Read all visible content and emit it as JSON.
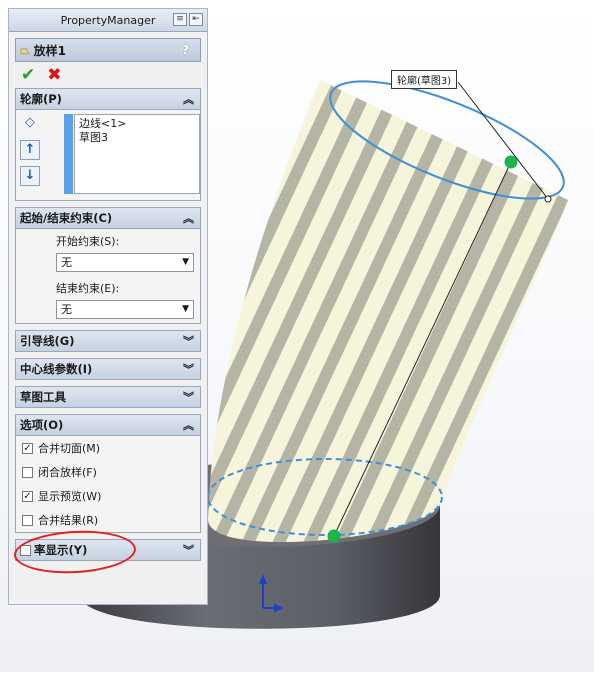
{
  "panel": {
    "tab_title": "PropertyManager",
    "feature_title": "放样1",
    "help_icon": "?"
  },
  "profile": {
    "header": "轮廓(P)",
    "items": [
      "边线<1>",
      "草图3"
    ]
  },
  "constraints": {
    "header": "起始/结束约束(C)",
    "start_label": "开始约束(S):",
    "start_value": "无",
    "end_label": "结束约束(E):",
    "end_value": "无"
  },
  "groups": {
    "guides": "引导线(G)",
    "centerline": "中心线参数(I)",
    "sketch_tools": "草图工具"
  },
  "options": {
    "header": "选项(O)",
    "merge_tangent": "合并切面(M)",
    "close_loft": "闭合放样(F)",
    "show_preview": "显示预览(W)",
    "merge_result": "合并结果(R)"
  },
  "curvature": {
    "header": "率显示(Y)"
  },
  "viewport": {
    "callout": "轮廓(草图3)"
  }
}
